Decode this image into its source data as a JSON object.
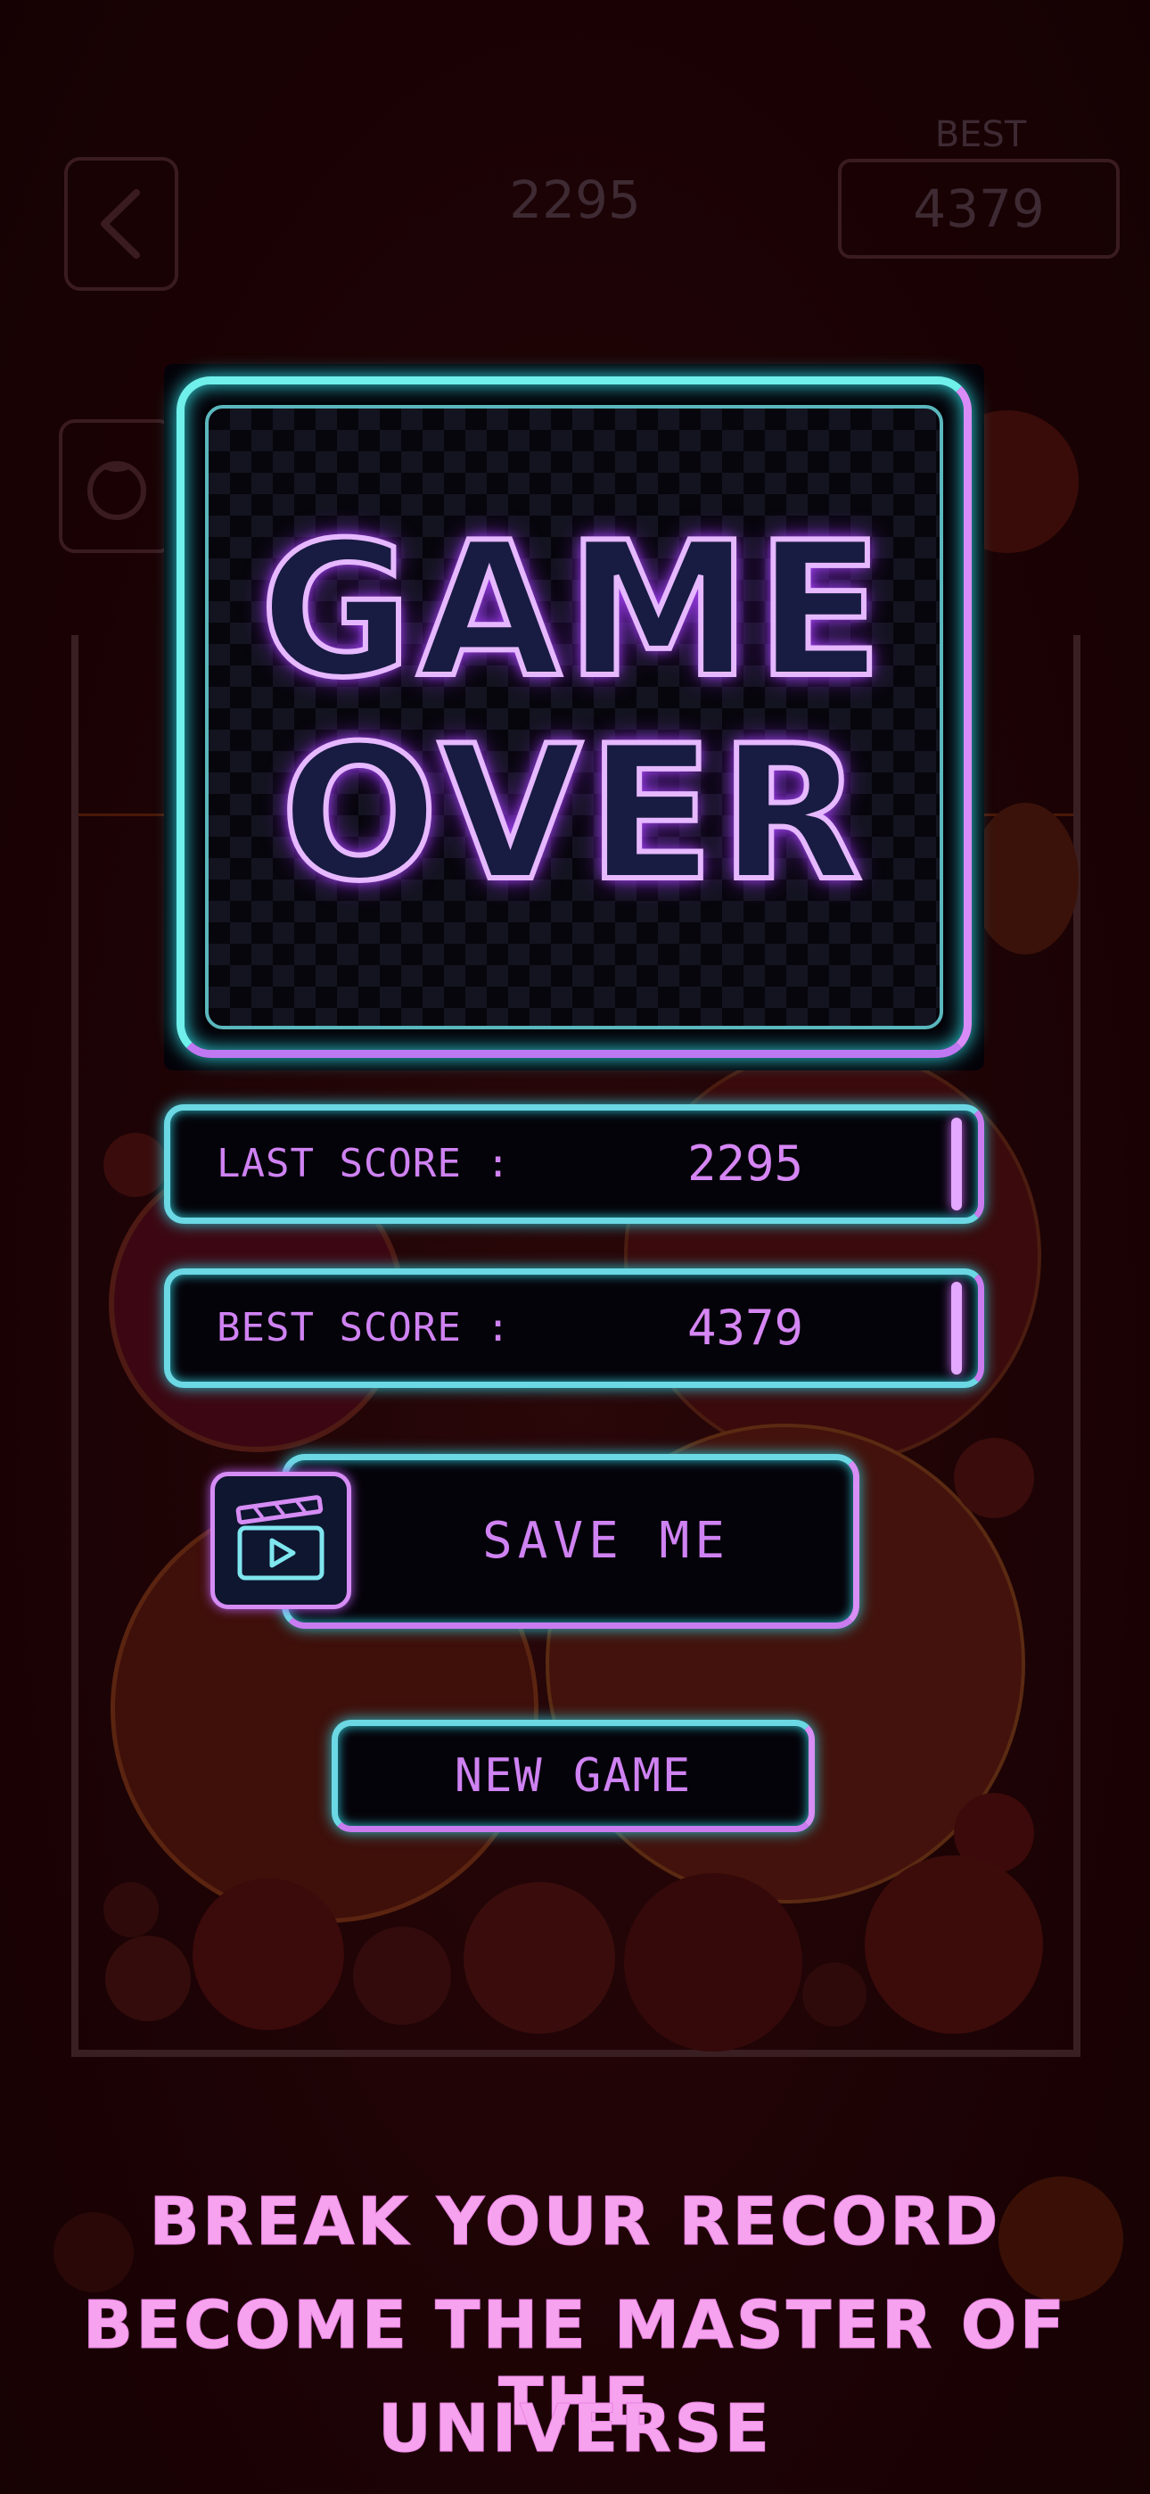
{
  "hud": {
    "score": "2295",
    "best_label": "BEST",
    "best_value": "4379"
  },
  "game_over": {
    "title_line1": "GAME",
    "title_line2": "OVER"
  },
  "scores": {
    "last_label": "LAST SCORE :",
    "last_value": "2295",
    "best_label": "BEST SCORE :",
    "best_value": "4379"
  },
  "buttons": {
    "save_me": "SAVE ME",
    "new_game": "NEW GAME"
  },
  "slogan": {
    "line1": "BREAK YOUR RECORD",
    "line2": "BECOME THE MASTER OF THE",
    "line3": "UNIVERSE"
  },
  "icons": {
    "back": "chevron-left-icon",
    "fruit": "tomato-icon",
    "video": "clapperboard-play-icon"
  },
  "colors": {
    "background": "#1a0204",
    "neon_cyan": "#6ff0ea",
    "neon_purple": "#d686f4",
    "slogan_pink": "#f7a2ef"
  }
}
